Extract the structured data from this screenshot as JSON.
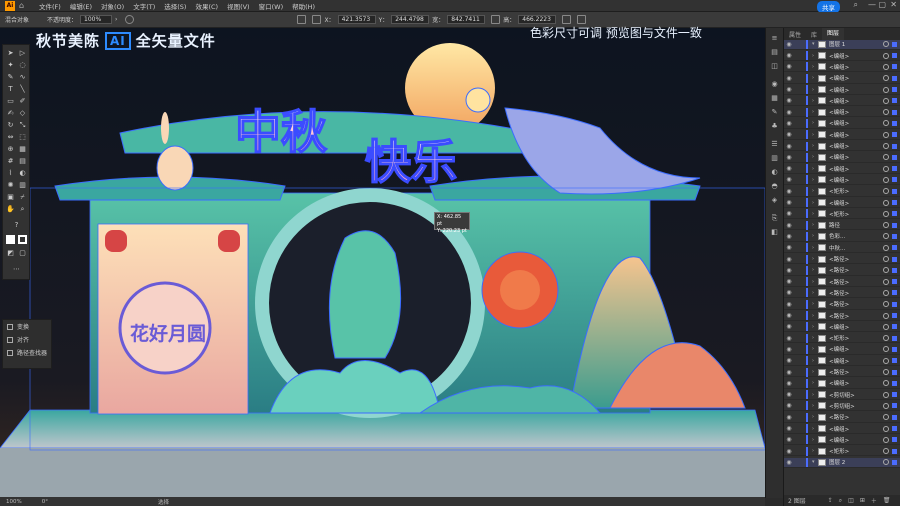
{
  "app": {
    "logo": "Ai"
  },
  "menu": [
    "文件(F)",
    "编辑(E)",
    "对象(O)",
    "文字(T)",
    "选择(S)",
    "效果(C)",
    "视图(V)",
    "窗口(W)",
    "帮助(H)"
  ],
  "share_label": "共享",
  "control_bar": {
    "selection_label": "混合对象",
    "opacity_label": "不透明度：",
    "opacity_value": "100%",
    "x_label": "X：",
    "x_value": "421.3573",
    "y_label": "Y：",
    "y_value": "244.4798",
    "w_label": "宽：",
    "w_value": "842.7411",
    "h_label": "高：",
    "h_value": "466.2223"
  },
  "artboard": {
    "headline_prefix": "秋节美陈",
    "headline_badge": "AI",
    "headline_suffix": "全矢量文件",
    "top_right_text": "色彩尺寸可调   预览图与文件一致",
    "main_title_1": "中秋",
    "main_title_2": "快乐",
    "sign_text": "花好月圆",
    "tooltip_x": "X: 462.85 pt",
    "tooltip_y": "Y: 220.23 pt"
  },
  "properties_panel": {
    "items": [
      "变换",
      "对齐",
      "路径查找器"
    ]
  },
  "layers_panel": {
    "tabs": [
      "属性",
      "库",
      "图层"
    ],
    "rows": [
      {
        "name": "图层 1",
        "level": 0
      },
      {
        "name": "<编组>",
        "level": 1
      },
      {
        "name": "<编组>",
        "level": 1
      },
      {
        "name": "<编组>",
        "level": 1
      },
      {
        "name": "<编组>",
        "level": 1
      },
      {
        "name": "<编组>",
        "level": 1
      },
      {
        "name": "<编组>",
        "level": 1
      },
      {
        "name": "<编组>",
        "level": 1
      },
      {
        "name": "<编组>",
        "level": 1
      },
      {
        "name": "<编组>",
        "level": 1
      },
      {
        "name": "<编组>",
        "level": 1
      },
      {
        "name": "<编组>",
        "level": 1
      },
      {
        "name": "<编组>",
        "level": 1
      },
      {
        "name": "<矩形>",
        "level": 1
      },
      {
        "name": "<编组>",
        "level": 1
      },
      {
        "name": "<矩形>",
        "level": 1
      },
      {
        "name": "路径",
        "level": 1
      },
      {
        "name": "色彩...",
        "level": 1
      },
      {
        "name": "中秋...",
        "level": 1
      },
      {
        "name": "<路径>",
        "level": 1
      },
      {
        "name": "<路径>",
        "level": 1
      },
      {
        "name": "<路径>",
        "level": 1
      },
      {
        "name": "<路径>",
        "level": 1
      },
      {
        "name": "<路径>",
        "level": 1
      },
      {
        "name": "<路径>",
        "level": 1
      },
      {
        "name": "<编组>",
        "level": 1
      },
      {
        "name": "<矩形>",
        "level": 1
      },
      {
        "name": "<编组>",
        "level": 1
      },
      {
        "name": "<编组>",
        "level": 1
      },
      {
        "name": "<路径>",
        "level": 1
      },
      {
        "name": "<编组>",
        "level": 1
      },
      {
        "name": "<剪切组>",
        "level": 1
      },
      {
        "name": "<剪切组>",
        "level": 1
      },
      {
        "name": "<路径>",
        "level": 1
      },
      {
        "name": "<编组>",
        "level": 1
      },
      {
        "name": "<编组>",
        "level": 1
      },
      {
        "name": "<矩形>",
        "level": 1
      },
      {
        "name": "图层 2",
        "level": 0
      }
    ],
    "footer": "2 图层"
  },
  "status_bar": {
    "zoom": "100%",
    "rotation": "0°",
    "tool": "选择"
  },
  "colors": {
    "accent_blue": "#4b6cff",
    "selection_blue": "#2d8bff",
    "ai_orange": "#ff9a00"
  }
}
